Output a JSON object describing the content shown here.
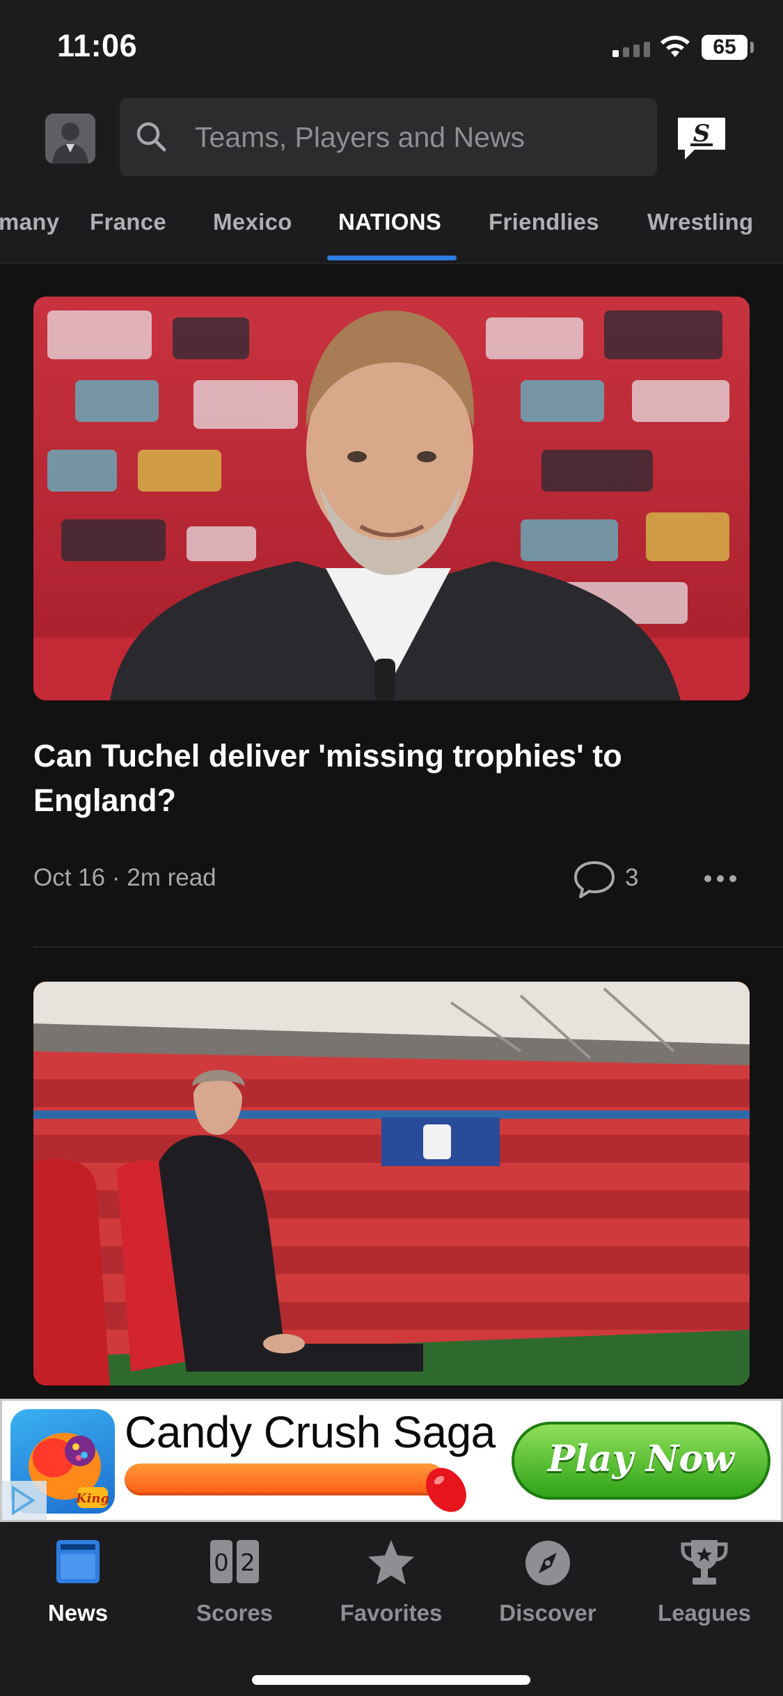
{
  "status_bar": {
    "time": "11:06",
    "battery": "65"
  },
  "header": {
    "search_placeholder": "Teams, Players and News"
  },
  "tabs": [
    {
      "label": "many",
      "active": false
    },
    {
      "label": "France",
      "active": false
    },
    {
      "label": "Mexico",
      "active": false
    },
    {
      "label": "NATIONS",
      "active": true
    },
    {
      "label": "Friendlies",
      "active": false
    },
    {
      "label": "Wrestling",
      "active": false
    }
  ],
  "articles": [
    {
      "title": "Can Tuchel deliver 'missing trophies' to England?",
      "date": "Oct 16",
      "read_time": "2m read",
      "comments": "3"
    },
    {}
  ],
  "ad": {
    "title": "Candy Crush Saga",
    "button": "Play Now",
    "logo_text": "King"
  },
  "bottom_nav": {
    "items": [
      {
        "label": "News",
        "icon": "news-icon",
        "active": true
      },
      {
        "label": "Scores",
        "icon": "scores-icon",
        "active": false,
        "score_a": "0",
        "score_b": "2"
      },
      {
        "label": "Favorites",
        "icon": "star-icon",
        "active": false
      },
      {
        "label": "Discover",
        "icon": "compass-icon",
        "active": false
      },
      {
        "label": "Leagues",
        "icon": "trophy-icon",
        "active": false
      }
    ]
  },
  "colors": {
    "accent": "#2f7de1",
    "background": "#121212",
    "header": "#1c1c1e",
    "muted": "#8e8e93"
  }
}
